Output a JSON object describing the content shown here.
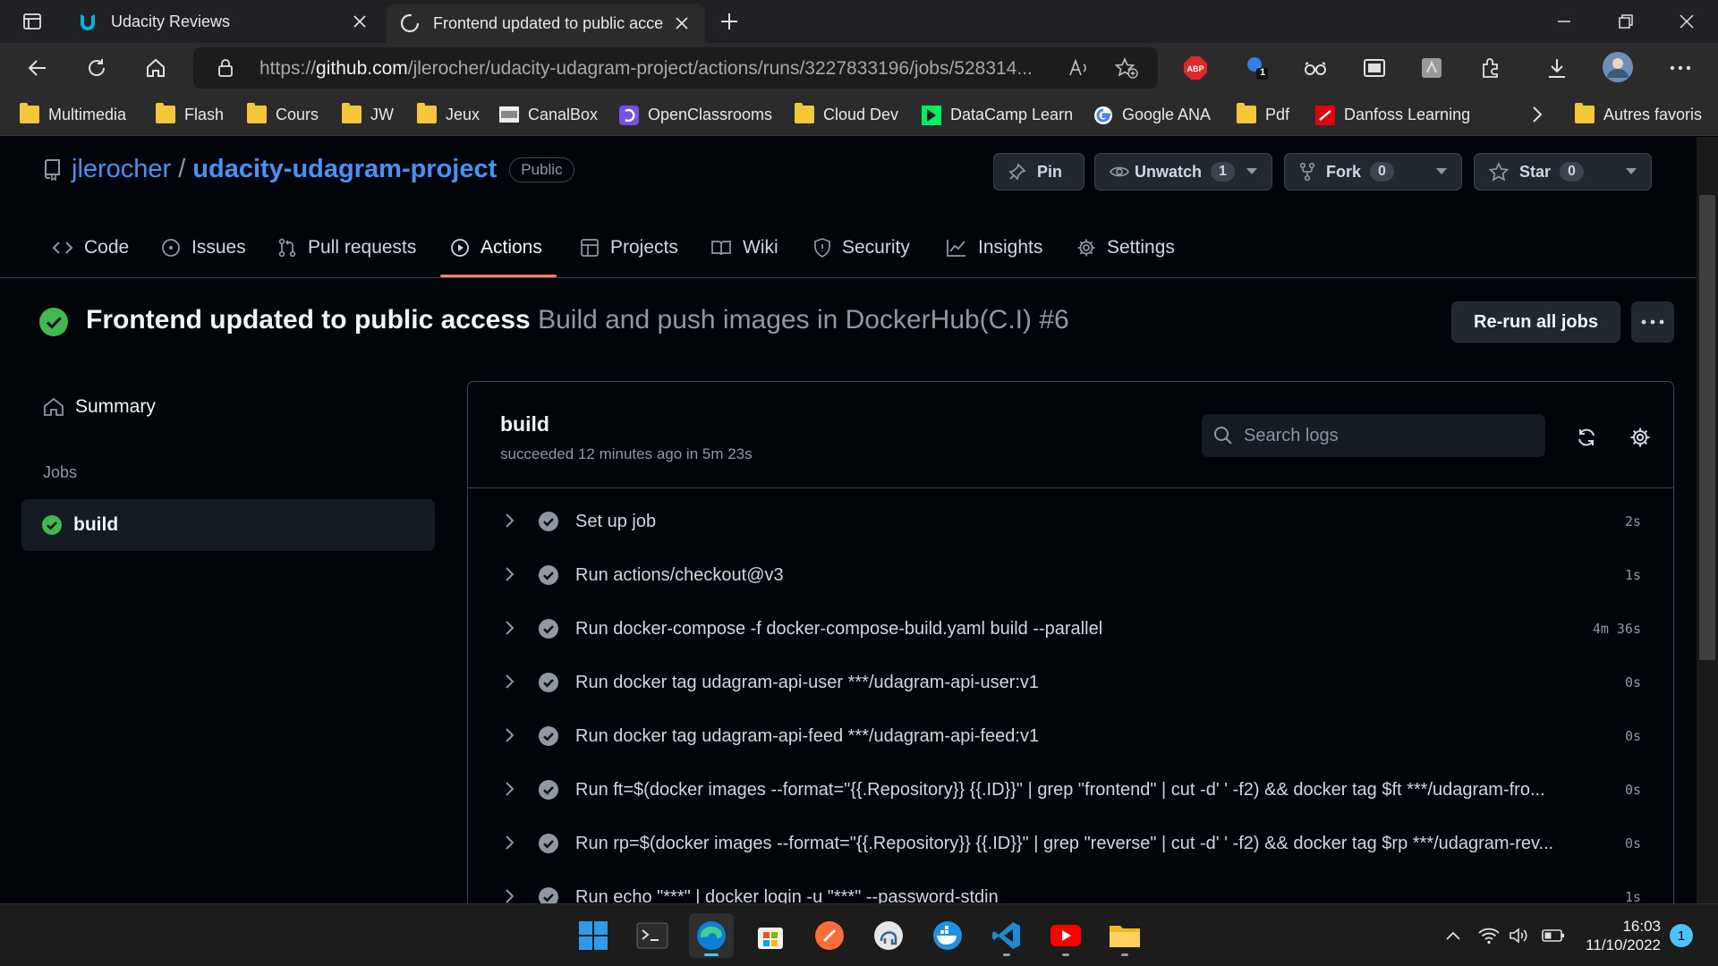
{
  "browser": {
    "tabs": [
      {
        "title": "Udacity Reviews",
        "active": false
      },
      {
        "title": "Frontend updated to public acce",
        "active": true
      }
    ],
    "url_prefix": "https://",
    "url_domain": "github.com",
    "url_path": "/jlerocher/udacity-udagram-project/actions/runs/3227833196/jobs/528314...",
    "bookmarks": [
      "Multimedia",
      "Flash",
      "Cours",
      "JW",
      "Jeux",
      "CanalBox",
      "OpenClassrooms",
      "Cloud Dev",
      "DataCamp Learn",
      "Google ANA",
      "Pdf",
      "Danfoss Learning"
    ],
    "other_bookmarks": "Autres favoris",
    "extension_badge": "1"
  },
  "repo": {
    "owner": "jlerocher",
    "separator": "/",
    "name": "udacity-udagram-project",
    "visibility": "Public",
    "pin_label": "Pin",
    "watch_label": "Unwatch",
    "watch_count": "1",
    "fork_label": "Fork",
    "fork_count": "0",
    "star_label": "Star",
    "star_count": "0"
  },
  "nav": {
    "items": [
      "Code",
      "Issues",
      "Pull requests",
      "Actions",
      "Projects",
      "Wiki",
      "Security",
      "Insights",
      "Settings"
    ],
    "active": "Actions"
  },
  "run": {
    "title": "Frontend updated to public access",
    "workflow": "Build and push images in DockerHub(C.I) #6",
    "rerun_label": "Re-run all jobs",
    "status_color": "#3fb950"
  },
  "sidebar": {
    "summary_label": "Summary",
    "jobs_heading": "Jobs",
    "job_name": "build"
  },
  "job": {
    "name": "build",
    "status_text": "succeeded 12 minutes ago in 5m 23s",
    "search_placeholder": "Search logs",
    "steps": [
      {
        "label": "Set up job",
        "duration": "2s"
      },
      {
        "label": "Run actions/checkout@v3",
        "duration": "1s"
      },
      {
        "label": "Run docker-compose -f docker-compose-build.yaml build --parallel",
        "duration": "4m 36s"
      },
      {
        "label": "Run docker tag udagram-api-user ***/udagram-api-user:v1",
        "duration": "0s"
      },
      {
        "label": "Run docker tag udagram-api-feed ***/udagram-api-feed:v1",
        "duration": "0s"
      },
      {
        "label": "Run ft=$(docker images --format=\"{{.Repository}} {{.ID}}\" | grep \"frontend\" | cut -d' ' -f2) && docker tag $ft ***/udagram-fro...",
        "duration": "0s"
      },
      {
        "label": "Run rp=$(docker images --format=\"{{.Repository}} {{.ID}}\" | grep \"reverse\" | cut -d' ' -f2) && docker tag $rp ***/udagram-rev...",
        "duration": "0s"
      },
      {
        "label": "Run echo \"***\" | docker login -u \"***\" --password-stdin",
        "duration": "1s"
      }
    ]
  },
  "taskbar": {
    "time": "16:03",
    "date": "11/10/2022",
    "notification_count": "1"
  }
}
